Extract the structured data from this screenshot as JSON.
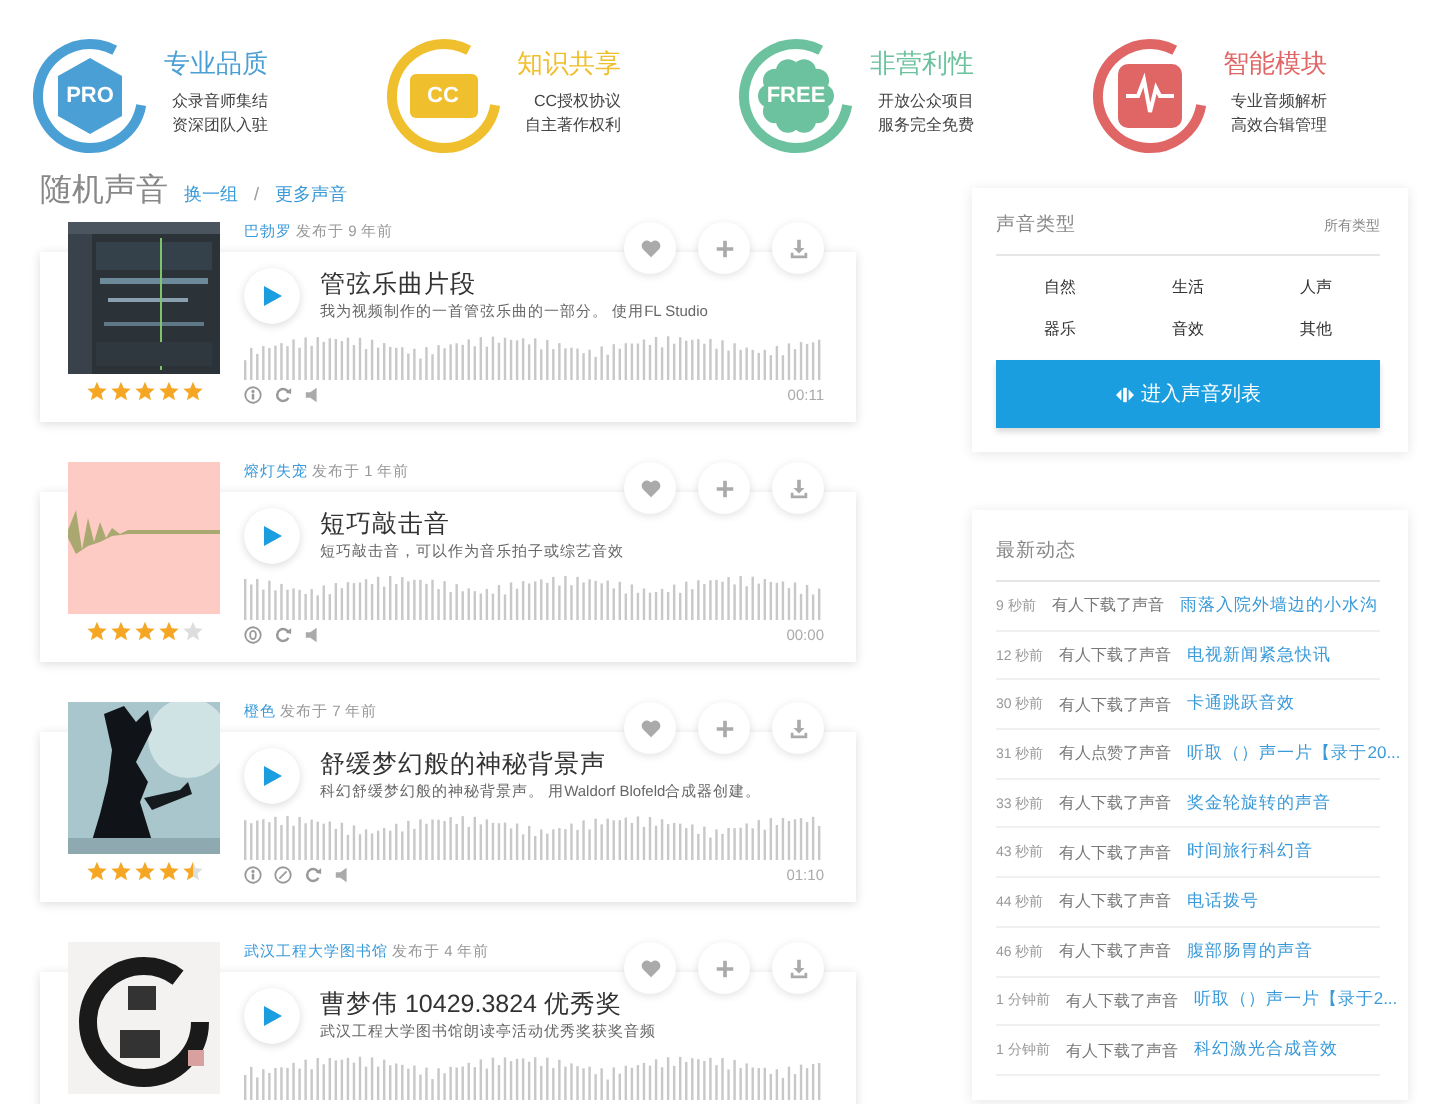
{
  "features": [
    {
      "kind": "hexagon",
      "badge": "PRO",
      "color": "#4a9fd5",
      "title": "专业品质",
      "lines": [
        "众录音师集结",
        "资深团队入驻"
      ]
    },
    {
      "kind": "rounded-rect",
      "badge": "CC",
      "color": "#f0bf2e",
      "title": "知识共享",
      "lines": [
        "CC授权协议",
        "自主著作权利"
      ]
    },
    {
      "kind": "flower",
      "badge": "FREE",
      "color": "#6cc29e",
      "title": "非营利性",
      "lines": [
        "开放公众项目",
        "服务完全免费"
      ]
    },
    {
      "kind": "pulse",
      "color": "#e06666",
      "title": "智能模块",
      "lines": [
        "专业音频解析",
        "高效合辑管理"
      ]
    }
  ],
  "section": {
    "title": "随机声音",
    "links": [
      "换一组",
      "更多声音"
    ],
    "separator": "/"
  },
  "sounds": [
    {
      "author": "巴勃罗",
      "posted": "发布于 9 年前",
      "title": "管弦乐曲片段",
      "description": "我为视频制作的一首管弦乐曲的一部分。 使用FL Studio",
      "time": "00:11",
      "stars": 5,
      "licenses": [
        {
          "kind": "attribution"
        }
      ]
    },
    {
      "author": "熔灯失宠",
      "posted": "发布于 1 年前",
      "title": "短巧敲击音",
      "description": "短巧敲击音，可以作为音乐拍子或综艺音效",
      "time": "00:00",
      "stars": 4,
      "licenses": [
        {
          "kind": "zero"
        }
      ]
    },
    {
      "author": "橙色",
      "posted": "发布于 7 年前",
      "title": "舒缓梦幻般的神秘背景声",
      "description": "科幻舒缓梦幻般的神秘背景声。 用Waldorf Blofeld合成器创建。",
      "time": "01:10",
      "stars": 4.5,
      "licenses": [
        {
          "kind": "attribution"
        },
        {
          "kind": "noncommercial"
        }
      ]
    },
    {
      "author": "武汉工程大学图书馆",
      "posted": "发布于 4 年前",
      "title": "曹梦伟 10429.3824 优秀奖",
      "description": "武汉工程大学图书馆朗读亭活动优秀奖获奖音频"
    }
  ],
  "categories": {
    "title": "声音类型",
    "all_link": "所有类型",
    "items": [
      "自然",
      "生活",
      "人声",
      "器乐",
      "音效",
      "其他"
    ],
    "button": "进入声音列表"
  },
  "activity": {
    "title": "最新动态",
    "items": [
      {
        "time": "9 秒前",
        "action": "有人下载了声音",
        "sound": "雨落入院外墙边的小水沟"
      },
      {
        "time": "12 秒前",
        "action": "有人下载了声音",
        "sound": "电视新闻紧急快讯"
      },
      {
        "time": "30 秒前",
        "action": "有人下载了声音",
        "sound": "卡通跳跃音效"
      },
      {
        "time": "31 秒前",
        "action": "有人点赞了声音",
        "sound": "听取（）声一片【录于20..."
      },
      {
        "time": "33 秒前",
        "action": "有人下载了声音",
        "sound": "奖金轮旋转的声音"
      },
      {
        "time": "43 秒前",
        "action": "有人下载了声音",
        "sound": "时间旅行科幻音"
      },
      {
        "time": "44 秒前",
        "action": "有人下载了声音",
        "sound": "电话拨号"
      },
      {
        "time": "46 秒前",
        "action": "有人下载了声音",
        "sound": "腹部肠胃的声音"
      },
      {
        "time": "1 分钟前",
        "action": "有人下载了声音",
        "sound": "听取（）声一片【录于2..."
      },
      {
        "time": "1 分钟前",
        "action": "有人下载了声音",
        "sound": "科幻激光合成音效"
      }
    ]
  }
}
